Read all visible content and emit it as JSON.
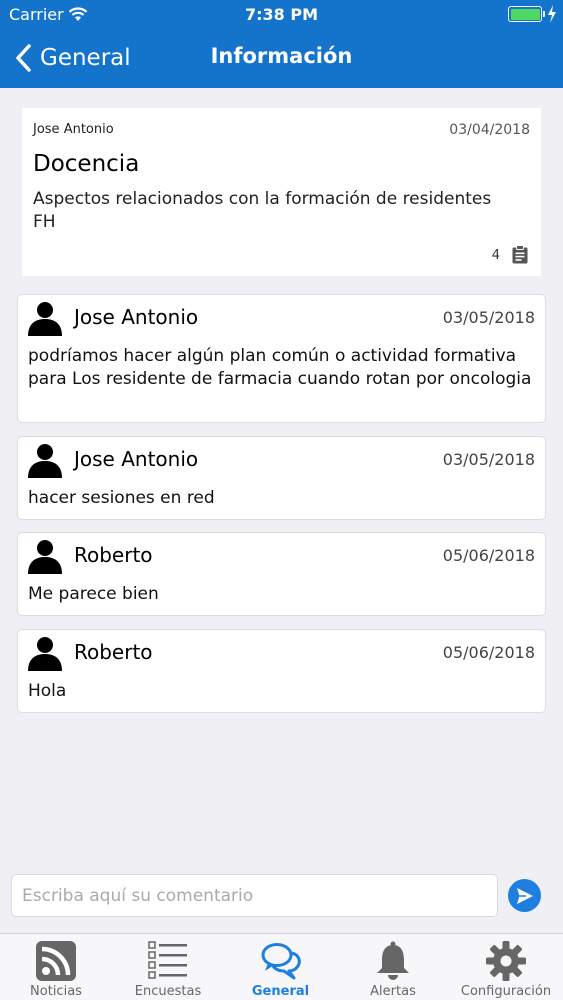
{
  "status_bar": {
    "carrier": "Carrier",
    "time": "7:38 PM"
  },
  "nav": {
    "back_label": "General",
    "title": "Información"
  },
  "topic": {
    "author": "Jose Antonio",
    "date": "03/04/2018",
    "title": "Docencia",
    "description": "Aspectos relacionados con la formación de residentes FH",
    "count": "4",
    "count_icon": "clipboard-icon"
  },
  "comments": [
    {
      "author": "Jose Antonio",
      "date": "03/05/2018",
      "text": "podríamos hacer algún plan común o actividad formativa para Los residente de farmacia cuando rotan por oncologia"
    },
    {
      "author": "Jose Antonio",
      "date": "03/05/2018",
      "text": "hacer sesiones en red"
    },
    {
      "author": "Roberto",
      "date": "05/06/2018",
      "text": "Me parece bien"
    },
    {
      "author": "Roberto",
      "date": "05/06/2018",
      "text": "Hola"
    }
  ],
  "input": {
    "placeholder": "Escriba aquí su comentario"
  },
  "tabs": [
    {
      "label": "Noticias",
      "icon": "rss-icon"
    },
    {
      "label": "Encuestas",
      "icon": "checklist-icon"
    },
    {
      "label": "General",
      "icon": "chat-bubbles-icon",
      "active": true
    },
    {
      "label": "Alertas",
      "icon": "bell-icon"
    },
    {
      "label": "Configuración",
      "icon": "gear-icon"
    }
  ],
  "colors": {
    "primary": "#1474cc",
    "accent": "#1f7fe0",
    "battery": "#4cd964",
    "background": "#efeff4"
  }
}
